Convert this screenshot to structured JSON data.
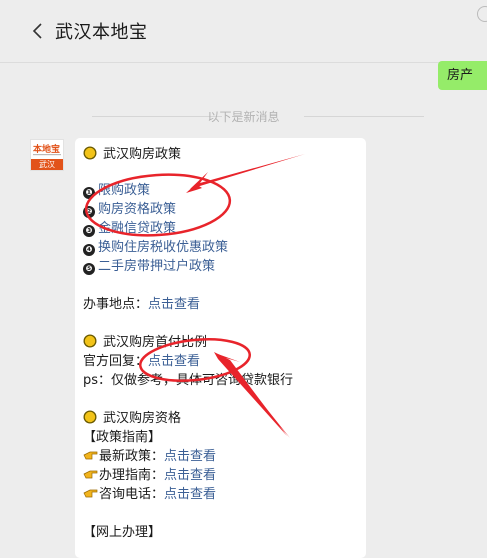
{
  "header": {
    "title": "武汉本地宝"
  },
  "chat": {
    "outgoing_message": "房产",
    "new_messages_divider": "以下是新消息"
  },
  "avatar": {
    "logo_text": "本地宝",
    "city_tag": "武汉"
  },
  "colors": {
    "link": "#3b5f95",
    "bubble": "#95ec69",
    "annotation": "#e8242b",
    "avatar_accent": "#e2531a"
  },
  "message": {
    "section1_title": "武汉购房政策",
    "policies": [
      {
        "num": "❶",
        "label": "限购政策"
      },
      {
        "num": "❷",
        "label": "购房资格政策"
      },
      {
        "num": "❸",
        "label": "金融信贷政策"
      },
      {
        "num": "❹",
        "label": "换购住房税收优惠政策"
      },
      {
        "num": "❺",
        "label": "二手房带押过户政策"
      }
    ],
    "office_label": "办事地点：",
    "office_link": "点击查看",
    "section2_title": "武汉购房首付比例",
    "official_reply_label": "官方回复：",
    "official_reply_link": "点击查看",
    "ps_note": "ps：仅做参考，具体可咨询贷款银行",
    "section3_title": "武汉购房资格",
    "guide_header": "【政策指南】",
    "guide_items": [
      {
        "label": "最新政策：",
        "link": "点击查看"
      },
      {
        "label": "办理指南：",
        "link": "点击查看"
      },
      {
        "label": "咨询电话：",
        "link": "点击查看"
      }
    ],
    "online_header": "【网上办理】"
  }
}
